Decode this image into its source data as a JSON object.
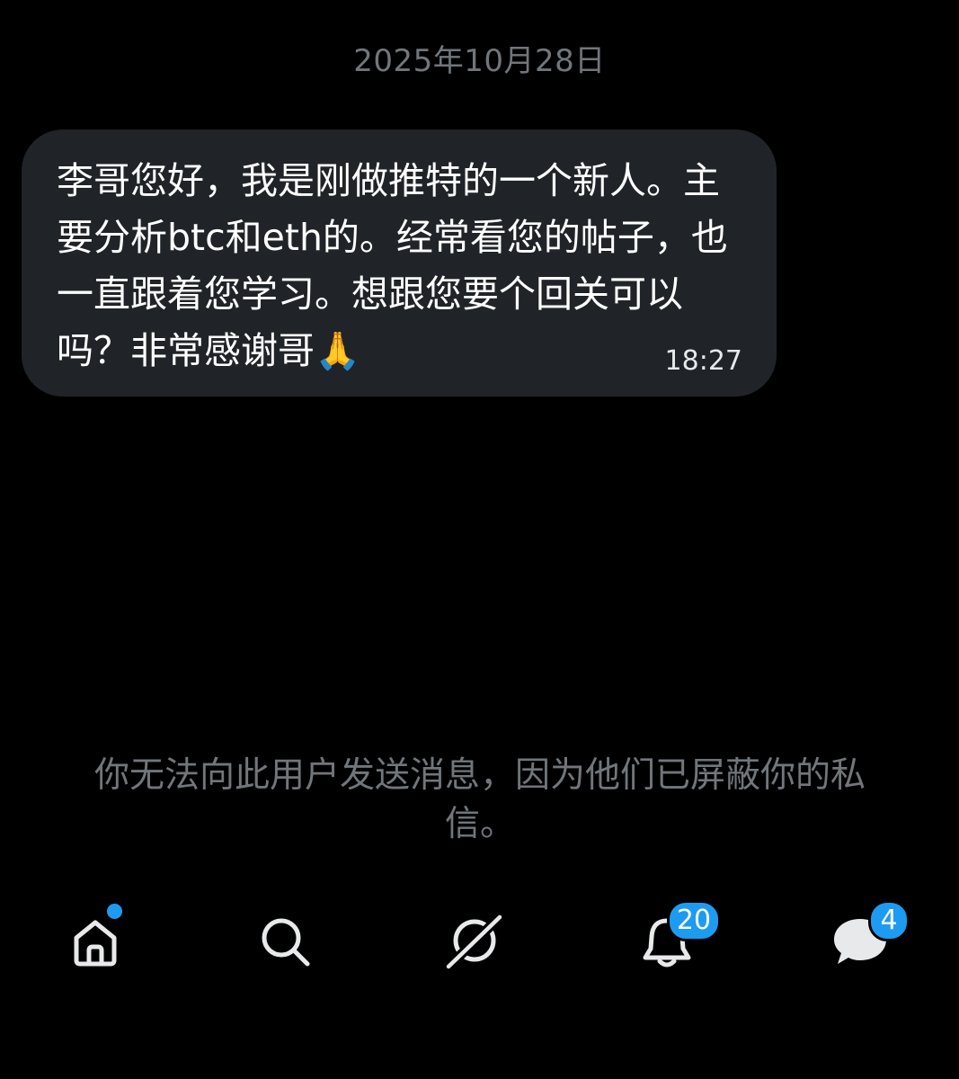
{
  "conversation": {
    "date_label": "2025年10月28日",
    "message": {
      "text": "李哥您好，我是刚做推特的一个新人。主要分析btc和eth的。经常看您的帖子，也一直跟着您学习。想跟您要个回关可以吗？非常感谢哥🙏",
      "time": "18:27"
    },
    "blocked_notice": "你无法向此用户发送消息，因为他们已屏蔽你的私信。"
  },
  "tabbar": {
    "tabs": [
      {
        "name": "home",
        "icon": "home-icon",
        "badge": null,
        "has_dot": true
      },
      {
        "name": "search",
        "icon": "search-icon",
        "badge": null,
        "has_dot": false
      },
      {
        "name": "grok",
        "icon": "grok-icon",
        "badge": null,
        "has_dot": false
      },
      {
        "name": "notifications",
        "icon": "bell-icon",
        "badge": "20",
        "has_dot": false
      },
      {
        "name": "messages",
        "icon": "messages-icon",
        "badge": "4",
        "has_dot": false
      }
    ]
  },
  "colors": {
    "background": "#000000",
    "bubble": "#202327",
    "muted_text": "#71767b",
    "accent": "#1d9bf0"
  }
}
